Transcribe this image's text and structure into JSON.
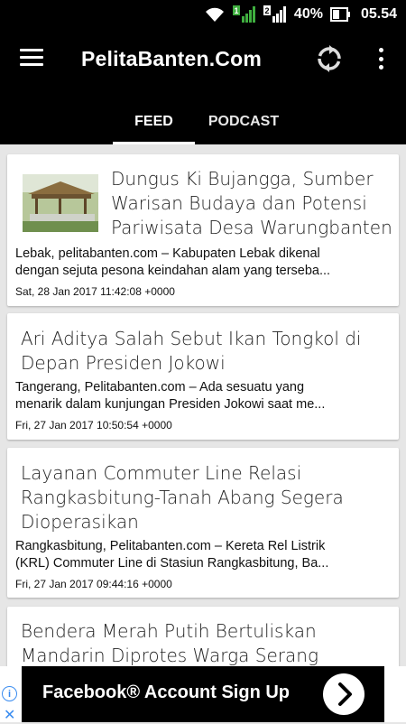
{
  "status_bar": {
    "battery": "40%",
    "time": "05.54",
    "sim1": "1",
    "sim2": "2"
  },
  "app_bar": {
    "title": "PelitaBanten.Com"
  },
  "tabs": [
    {
      "label": "FEED",
      "selected": true
    },
    {
      "label": "PODCAST",
      "selected": false
    }
  ],
  "articles": [
    {
      "title_lines": [
        "Dungus Ki Bujangga, Sumber",
        "Warisan Budaya dan Potensi",
        "Pariwisata Desa Warungbanten"
      ],
      "summary_lines": [
        "Lebak, pelitabanten.com – Kabupaten Lebak dikenal",
        "dengan sejuta pesona keindahan alam yang terseba..."
      ],
      "date": "Sat, 28 Jan 2017 11:42:08 +0000",
      "has_thumbnail": true
    },
    {
      "title_lines": [
        "Ari Aditya Salah Sebut Ikan Tongkol di",
        "Depan Presiden Jokowi"
      ],
      "summary_lines": [
        "Tangerang, Pelitabanten.com – Ada sesuatu yang",
        "menarik dalam kunjungan Presiden Jokowi  saat me..."
      ],
      "date": "Fri, 27 Jan 2017 10:50:54 +0000",
      "has_thumbnail": false
    },
    {
      "title_lines": [
        "Layanan Commuter Line Relasi",
        "Rangkasbitung-Tanah Abang Segera",
        "Dioperasikan"
      ],
      "summary_lines": [
        "Rangkasbitung, Pelitabanten.com – Kereta Rel Listrik",
        "(KRL) Commuter Line di Stasiun Rangkasbitung, Ba..."
      ],
      "date": "Fri, 27 Jan 2017 09:44:16 +0000",
      "has_thumbnail": false
    },
    {
      "title_lines": [
        "Bendera Merah Putih Bertuliskan",
        "Mandarin Diprotes Warga Serang"
      ],
      "summary_lines": [],
      "date": "",
      "has_thumbnail": false
    }
  ],
  "ad": {
    "text": "Facebook® Account Sign Up",
    "info_glyph": "i",
    "close_glyph": "✕"
  },
  "colors": {
    "app_bar": "#000000",
    "background": "#e6e6e6",
    "ad_accent": "#3a8cf0"
  }
}
